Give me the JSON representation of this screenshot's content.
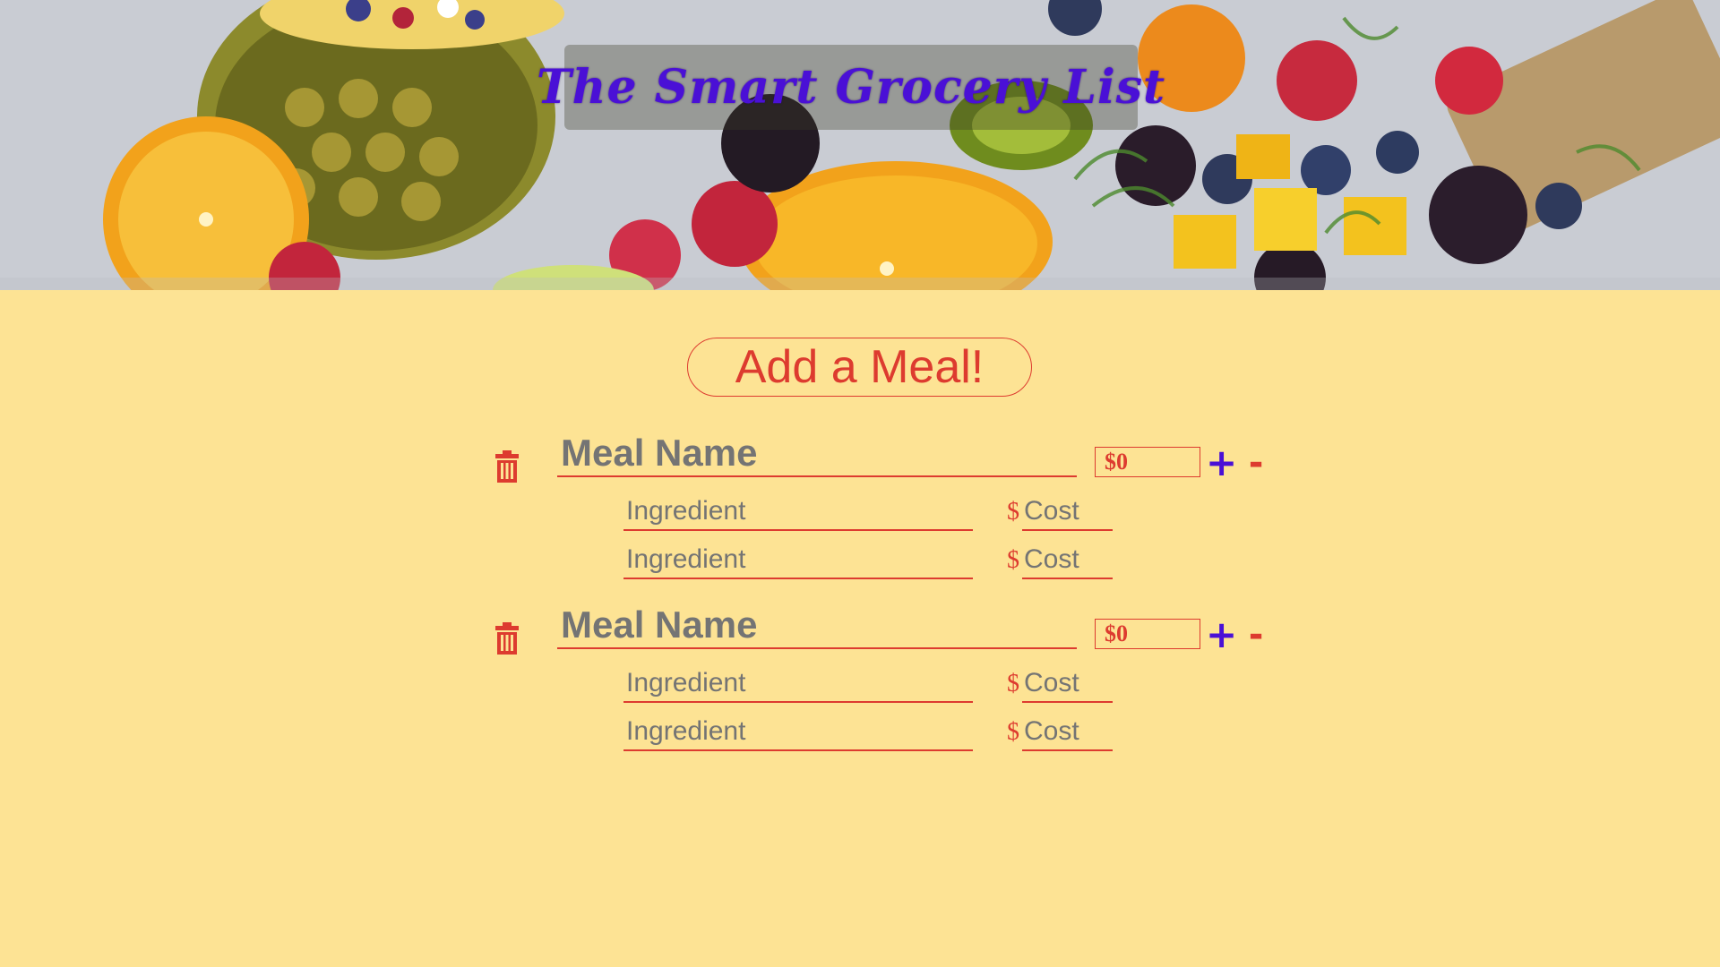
{
  "header": {
    "title": "The Smart Grocery List",
    "background_image": "fruit-platter-photo"
  },
  "colors": {
    "background": "#fde394",
    "accent_red": "#dd3b2f",
    "title_purple": "#4a10d6",
    "text_gray": "#747474"
  },
  "actions": {
    "add_meal_label": "Add a Meal!"
  },
  "meals": [
    {
      "name_placeholder": "Meal Name",
      "total": "$0",
      "plus_label": "+",
      "minus_label": "-",
      "delete_icon": "trash-icon",
      "ingredients": [
        {
          "name_placeholder": "Ingredient",
          "currency": "$",
          "cost_placeholder": "Cost"
        },
        {
          "name_placeholder": "Ingredient",
          "currency": "$",
          "cost_placeholder": "Cost"
        }
      ]
    },
    {
      "name_placeholder": "Meal Name",
      "total": "$0",
      "plus_label": "+",
      "minus_label": "-",
      "delete_icon": "trash-icon",
      "ingredients": [
        {
          "name_placeholder": "Ingredient",
          "currency": "$",
          "cost_placeholder": "Cost"
        },
        {
          "name_placeholder": "Ingredient",
          "currency": "$",
          "cost_placeholder": "Cost"
        }
      ]
    }
  ]
}
